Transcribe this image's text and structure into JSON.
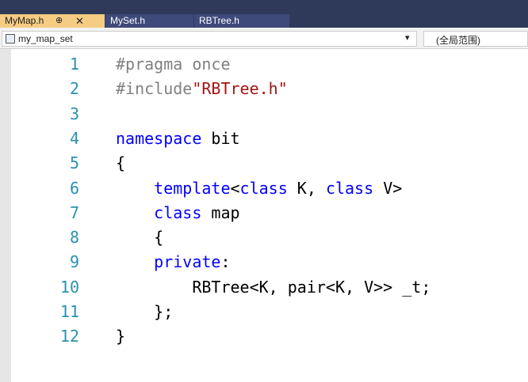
{
  "tabs": [
    {
      "label": "MyMap.h",
      "pin": "⊕",
      "close": "✕"
    },
    {
      "label": "MySet.h"
    },
    {
      "label": "RBTree.h"
    }
  ],
  "nav": {
    "scope": "my_map_set",
    "member": "(全局范围)"
  },
  "colors": {
    "keyword": "#0000ff",
    "preprocessor": "#808080",
    "string": "#a31515",
    "line_number": "#2b91af",
    "text": "#000000",
    "active_tab": "#f5cc84"
  },
  "editor": {
    "lines": [
      {
        "num": "1",
        "tokens": [
          {
            "t": "#pragma once",
            "c": "#808080"
          }
        ]
      },
      {
        "num": "2",
        "tokens": [
          {
            "t": "#include",
            "c": "#808080"
          },
          {
            "t": "\"RBTree.h\"",
            "c": "#a31515"
          }
        ]
      },
      {
        "num": "3",
        "tokens": []
      },
      {
        "num": "4",
        "tokens": [
          {
            "t": "namespace",
            "c": "#0000ff"
          },
          {
            "t": " bit",
            "c": "#000000"
          }
        ]
      },
      {
        "num": "5",
        "tokens": [
          {
            "t": "{",
            "c": "#000000"
          }
        ]
      },
      {
        "num": "6",
        "tokens": [
          {
            "t": "    ",
            "c": "#000000"
          },
          {
            "t": "template",
            "c": "#0000ff"
          },
          {
            "t": "<",
            "c": "#000000"
          },
          {
            "t": "class",
            "c": "#0000ff"
          },
          {
            "t": " K, ",
            "c": "#000000"
          },
          {
            "t": "class",
            "c": "#0000ff"
          },
          {
            "t": " V>",
            "c": "#000000"
          }
        ]
      },
      {
        "num": "7",
        "tokens": [
          {
            "t": "    ",
            "c": "#000000"
          },
          {
            "t": "class",
            "c": "#0000ff"
          },
          {
            "t": " map",
            "c": "#000000"
          }
        ]
      },
      {
        "num": "8",
        "tokens": [
          {
            "t": "    {",
            "c": "#000000"
          }
        ]
      },
      {
        "num": "9",
        "tokens": [
          {
            "t": "    ",
            "c": "#000000"
          },
          {
            "t": "private",
            "c": "#0000ff"
          },
          {
            "t": ":",
            "c": "#000000"
          }
        ]
      },
      {
        "num": "10",
        "tokens": [
          {
            "t": "        RBTree<K, pair<K, V>> _t;",
            "c": "#000000"
          }
        ]
      },
      {
        "num": "11",
        "tokens": [
          {
            "t": "    };",
            "c": "#000000"
          }
        ]
      },
      {
        "num": "12",
        "tokens": [
          {
            "t": "}",
            "c": "#000000"
          }
        ]
      }
    ]
  }
}
